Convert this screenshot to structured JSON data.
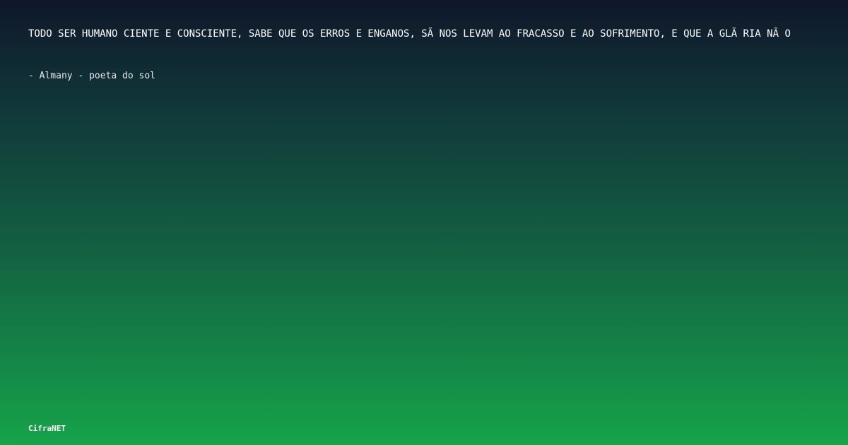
{
  "quote": {
    "text": "TODO SER HUMANO CIENTE E CONSCIENTE, SABE QUE OS ERROS E ENGANOS, SÃ NOS LEVAM AO FRACASSO E AO SOFRIMENTO, E QUE A GLÃ RIA NÃ O"
  },
  "attribution": {
    "text": "- Almany - poeta do sol"
  },
  "footer": {
    "brand": "CifraNET"
  },
  "colors": {
    "gradient_top": "#0f172a",
    "gradient_bottom": "#16a34a",
    "text": "#ffffff"
  }
}
